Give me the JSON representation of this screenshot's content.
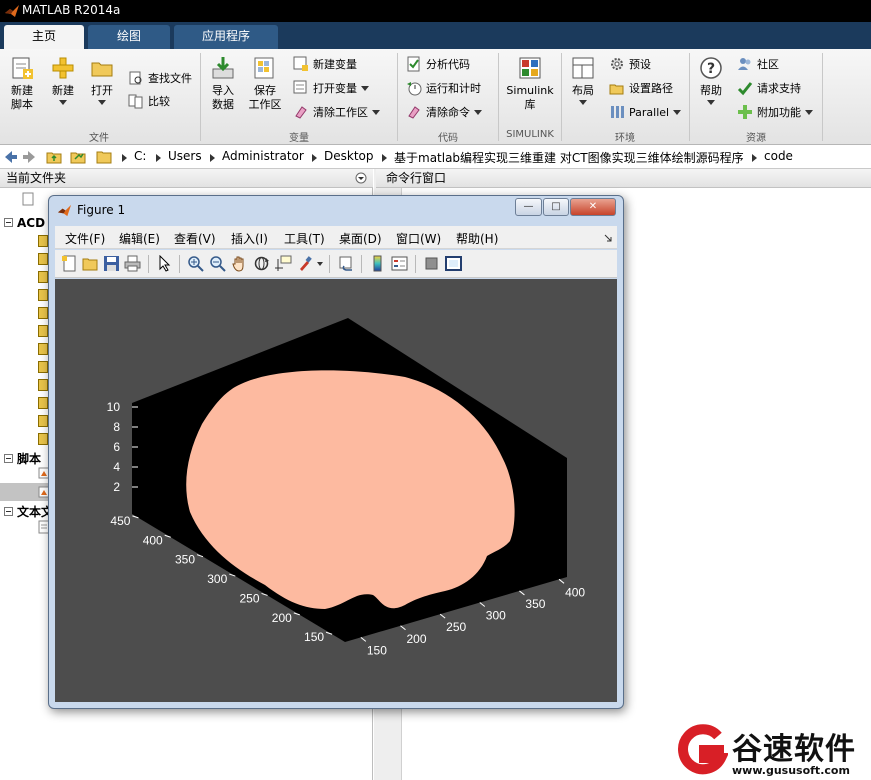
{
  "app": {
    "title": "MATLAB R2014a"
  },
  "tabs": [
    {
      "label": "主页"
    },
    {
      "label": "绘图"
    },
    {
      "label": "应用程序"
    }
  ],
  "ribbon": {
    "file_group": {
      "label": "文件",
      "new_script": "新建\n脚本",
      "new": "新建",
      "open": "打开",
      "find_files": "查找文件",
      "compare": "比较"
    },
    "variable_group": {
      "label": "变量",
      "import_data": "导入\n数据",
      "save_workspace": "保存\n工作区",
      "new_variable": "新建变量",
      "open_variable": "打开变量",
      "clear_workspace": "清除工作区"
    },
    "code_group": {
      "label": "代码",
      "analyze_code": "分析代码",
      "run_and_time": "运行和计时",
      "clear_commands": "清除命令"
    },
    "simulink_group": {
      "label": "SIMULINK",
      "simulink_library": "Simulink\n库"
    },
    "environment_group": {
      "label": "环境",
      "layout": "布局",
      "preferences": "预设",
      "set_path": "设置路径",
      "parallel": "Parallel"
    },
    "resources_group": {
      "label": "资源",
      "help": "帮助",
      "community": "社区",
      "request_support": "请求支持",
      "add_ons": "附加功能"
    }
  },
  "address": {
    "crumbs": [
      "C:",
      "Users",
      "Administrator",
      "Desktop",
      "基于matlab编程实现三维重建 对CT图像实现三维体绘制源码程序",
      "code"
    ]
  },
  "left_panel": {
    "title": "当前文件夹",
    "sections": [
      {
        "label": "ACD"
      },
      {
        "label": "脚本"
      },
      {
        "label": "文本文"
      }
    ]
  },
  "right_panel": {
    "title": "命令行窗口"
  },
  "figure": {
    "title": "Figure 1",
    "menus": [
      "文件(F)",
      "编辑(E)",
      "查看(V)",
      "插入(I)",
      "工具(T)",
      "桌面(D)",
      "窗口(W)",
      "帮助(H)"
    ],
    "plot_background": "#4d4d4d",
    "surface_color": "#fdbaa0",
    "axes_color": "#000000"
  },
  "chart_data": {
    "type": "surface-3d",
    "title": "",
    "z_ticks": [
      "2",
      "4",
      "6",
      "8",
      "10"
    ],
    "y_ticks": [
      "150",
      "200",
      "250",
      "300",
      "350",
      "400",
      "450"
    ],
    "x_ticks": [
      "150",
      "200",
      "250",
      "300",
      "350",
      "400"
    ],
    "zlim": [
      1,
      10
    ],
    "ylim": [
      130,
      460
    ],
    "xlim": [
      130,
      410
    ],
    "grid": false,
    "surface_color": "#fdbaa0"
  },
  "watermark": {
    "brand": "谷速软件",
    "url": "www.gususoft.com"
  }
}
